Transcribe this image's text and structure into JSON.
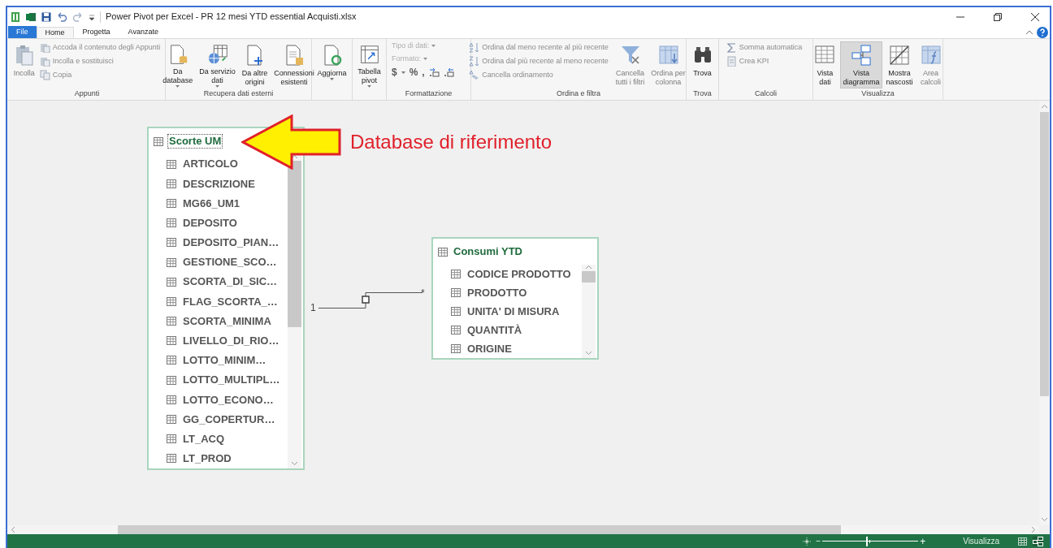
{
  "title_bar": {
    "title": "Power Pivot per Excel - PR 12 mesi YTD essential Acquisti.xlsx"
  },
  "tabs": [
    {
      "label": "File",
      "kind": "file",
      "selected": false
    },
    {
      "label": "Home",
      "kind": "tab",
      "selected": true
    },
    {
      "label": "Progetta",
      "kind": "tab",
      "selected": false
    },
    {
      "label": "Avanzate",
      "kind": "tab",
      "selected": false
    }
  ],
  "ribbon": {
    "groups": [
      {
        "label": "Appunti",
        "items": [
          {
            "kind": "large",
            "lines": [
              "Incolla"
            ],
            "disabled": true,
            "dropdown": false
          },
          {
            "kind": "stack",
            "entries": [
              {
                "label": "Accoda il contenuto degli Appunti",
                "disabled": true
              },
              {
                "label": "Incolla e sostituisci",
                "disabled": true
              },
              {
                "label": "Copia",
                "disabled": true
              }
            ]
          }
        ]
      },
      {
        "label": "Recupera dati esterni",
        "items": [
          {
            "kind": "large",
            "lines": [
              "Da",
              "database"
            ],
            "disabled": false,
            "dropdown": true
          },
          {
            "kind": "large",
            "lines": [
              "Da servizio",
              "dati"
            ],
            "disabled": false,
            "dropdown": true
          },
          {
            "kind": "large",
            "lines": [
              "Da altre",
              "origini"
            ],
            "disabled": false,
            "dropdown": false
          },
          {
            "kind": "large",
            "lines": [
              "Connessioni",
              "esistenti"
            ],
            "disabled": false,
            "dropdown": false
          }
        ]
      },
      {
        "items": [
          {
            "kind": "large",
            "lines": [
              "Aggiorna"
            ],
            "disabled": false,
            "dropdown": true
          }
        ]
      },
      {
        "items": [
          {
            "kind": "large",
            "lines": [
              "Tabella",
              "pivot"
            ],
            "disabled": false,
            "dropdown": true
          }
        ]
      },
      {
        "label": "Formattazione",
        "items": [
          {
            "kind": "format",
            "entries": [
              {
                "label": "Tipo di dati:",
                "disabled": true
              },
              {
                "label": "Formato:",
                "disabled": true
              }
            ],
            "symbols": [
              "$",
              "%",
              ","
            ],
            "disabled": true
          }
        ]
      },
      {
        "label": "Ordina e filtra",
        "items": [
          {
            "kind": "stack",
            "entries": [
              {
                "label": "Ordina dal meno recente al più recente",
                "disabled": true
              },
              {
                "label": "Ordina dal più recente al meno recente",
                "disabled": true
              },
              {
                "label": "Cancella ordinamento",
                "disabled": true
              }
            ]
          },
          {
            "kind": "large",
            "lines": [
              "Cancella",
              "tutti i filtri"
            ],
            "disabled": true,
            "dropdown": false
          },
          {
            "kind": "large",
            "lines": [
              "Ordina per",
              "colonna"
            ],
            "disabled": true,
            "dropdown": false
          }
        ]
      },
      {
        "label": "Trova",
        "items": [
          {
            "kind": "large",
            "lines": [
              "Trova"
            ],
            "disabled": false,
            "dropdown": false
          }
        ]
      },
      {
        "label": "Calcoli",
        "items": [
          {
            "kind": "stack",
            "entries": [
              {
                "label": "Somma automatica",
                "disabled": true
              },
              {
                "label": "Crea KPI",
                "disabled": true
              }
            ]
          }
        ]
      },
      {
        "label": "Visualizza",
        "items": [
          {
            "kind": "large",
            "lines": [
              "Vista",
              "dati"
            ],
            "disabled": false,
            "dropdown": false,
            "selected": false
          },
          {
            "kind": "large",
            "lines": [
              "Vista",
              "diagramma"
            ],
            "disabled": false,
            "dropdown": false,
            "selected": true
          },
          {
            "kind": "large",
            "lines": [
              "Mostra",
              "nascosti"
            ],
            "disabled": false,
            "dropdown": false,
            "selected": false
          },
          {
            "kind": "large",
            "lines": [
              "Area",
              "calcoli"
            ],
            "disabled": true,
            "dropdown": false,
            "selected": false
          }
        ]
      }
    ]
  },
  "diagram": {
    "tables": [
      {
        "title": "Scorte UM",
        "focused": true,
        "columns": [
          "ARTICOLO",
          "DESCRIZIONE",
          "MG66_UM1",
          "DEPOSITO",
          "DEPOSITO_PIAN…",
          "GESTIONE_SCO…",
          "SCORTA_DI_SIC…",
          "FLAG_SCORTA_…",
          "SCORTA_MINIMA",
          "LIVELLO_DI_RIO…",
          "LOTTO_MINIM…",
          "LOTTO_MULTIPL…",
          "LOTTO_ECONO…",
          "GG_COPERTUR…",
          "LT_ACQ",
          "LT_PROD"
        ]
      },
      {
        "title": "Consumi YTD",
        "focused": false,
        "columns": [
          "CODICE PRODOTTO",
          "PRODOTTO",
          "UNITA' DI MISURA",
          "QUANTITÀ",
          "ORIGINE"
        ]
      }
    ],
    "relationship": {
      "from_label": "1",
      "to_label": "*"
    },
    "annotation": {
      "text": "Database di riferimento"
    }
  },
  "status_bar": {
    "zoom": {
      "minus": "−",
      "plus": "+",
      "level": 0.46
    },
    "label": "Visualizza",
    "views": [
      {
        "selected": false
      },
      {
        "selected": true
      }
    ]
  }
}
